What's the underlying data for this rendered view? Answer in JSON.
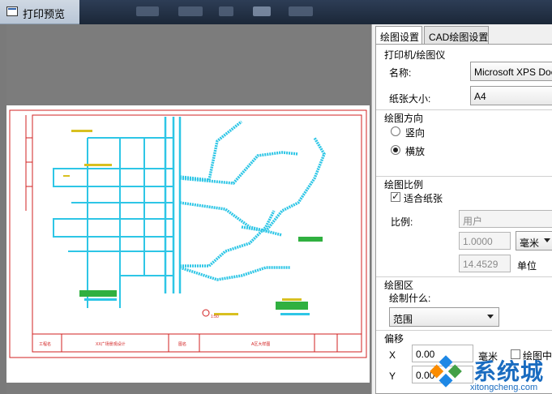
{
  "window": {
    "title": "打印预览"
  },
  "tabs": [
    {
      "label": "绘图设置",
      "active": true
    },
    {
      "label": "CAD绘图设置",
      "active": false
    }
  ],
  "printer_group": {
    "title": "打印机/绘图仪",
    "name_label": "名称:",
    "name_value": "Microsoft XPS Docu",
    "paper_label": "纸张大小:",
    "paper_value": "A4"
  },
  "orientation_group": {
    "title": "绘图方向",
    "portrait_label": "竖向",
    "landscape_label": "横放",
    "selected": "landscape"
  },
  "scale_group": {
    "title": "绘图比例",
    "fit_label": "适合纸张",
    "fit_checked": true,
    "ratio_label": "比例:",
    "ratio_value": "用户",
    "value1": "1.0000",
    "unit1": "毫米",
    "value2": "14.4529",
    "unit2": "单位"
  },
  "plot_area_group": {
    "title": "绘图区",
    "what_label": "绘制什么:",
    "what_value": "范围"
  },
  "offset_group": {
    "title": "偏移",
    "x_label": "X",
    "x_value": "0.00",
    "x_unit": "毫米",
    "center_label": "绘图中心",
    "y_label": "Y",
    "y_value": "0.00"
  },
  "drawing": {
    "title_block": [
      "工程名",
      "XX广场景观设计",
      "图名",
      "A区大样图"
    ],
    "scale_note": "1:50"
  },
  "watermark": {
    "brand": "系统城",
    "url": "xitongcheng.com"
  },
  "colors": {
    "cad_cyan": "#2ec6e6",
    "cad_red": "#d22020",
    "cad_yellow": "#d8c020",
    "cad_green": "#30b040"
  }
}
